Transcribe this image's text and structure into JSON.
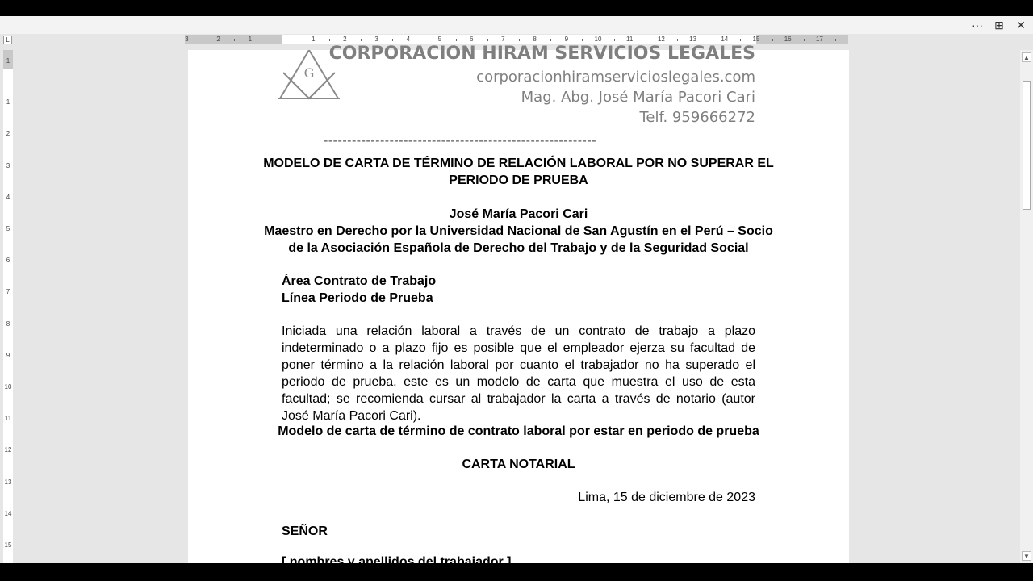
{
  "window": {
    "more_icon": "ellipsis-icon",
    "layout_icon": "layout-icon",
    "close_icon": "close-icon",
    "more_glyph": "···",
    "layout_glyph": "⊞",
    "close_glyph": "✕"
  },
  "ruler": {
    "horizontal_labels": [
      "3",
      "2",
      "1",
      "1",
      "2",
      "3",
      "4",
      "5",
      "6",
      "7",
      "8",
      "9",
      "10",
      "11",
      "12",
      "13",
      "14",
      "15",
      "16",
      "17"
    ],
    "vertical_labels": [
      "1",
      "1",
      "2",
      "3",
      "4",
      "5",
      "6",
      "7",
      "8",
      "9",
      "10",
      "11",
      "12",
      "13",
      "14",
      "15"
    ],
    "tab_selector": "L"
  },
  "header": {
    "company": "CORPORACION HIRAM SERVICIOS LEGALES",
    "website": "corporacionhiramservicioslegales.com",
    "author": "Mag. Abg. José María Pacori Cari",
    "phone": "Telf. 959666272",
    "logo_icon": "masonic-square-compass-icon",
    "logo_letter": "G",
    "separator": "----------------------------------------------------------"
  },
  "document": {
    "title_line1": "MODELO DE CARTA DE TÉRMINO DE RELACIÓN LABORAL POR NO SUPERAR EL",
    "title_line2": "PERIODO DE PRUEBA",
    "author_name": "José María Pacori Cari",
    "author_credentials_line1": "Maestro en Derecho por la Universidad Nacional de San Agustín en el Perú – Socio",
    "author_credentials_line2": "de la Asociación Española de Derecho del Trabajo y de la Seguridad Social",
    "area": "Área Contrato de Trabajo",
    "line": "Línea Periodo de Prueba",
    "intro_paragraph": "Iniciada una relación laboral a través de un contrato de trabajo a plazo indeterminado o a plazo fijo es posible que el empleador ejerza su facultad de poner término a la relación laboral por cuanto el trabajador no ha superado el periodo de prueba, este es un modelo de carta que muestra el uso de esta facultad; se recomienda cursar al trabajador la carta a través de notario (autor José María Pacori Cari).",
    "model_heading": "Modelo de carta de término de contrato laboral por estar en periodo de prueba",
    "letter_type": "CARTA NOTARIAL",
    "date_line": "Lima, 15 de diciembre de 2023",
    "salutation": "SEÑOR",
    "recipient_placeholder": "[   nombres y apellidos del trabajador   ]"
  },
  "scrollbar": {
    "up_icon": "scroll-up-icon",
    "down_icon": "scroll-down-icon",
    "up_glyph": "▲",
    "down_glyph": "▼"
  }
}
